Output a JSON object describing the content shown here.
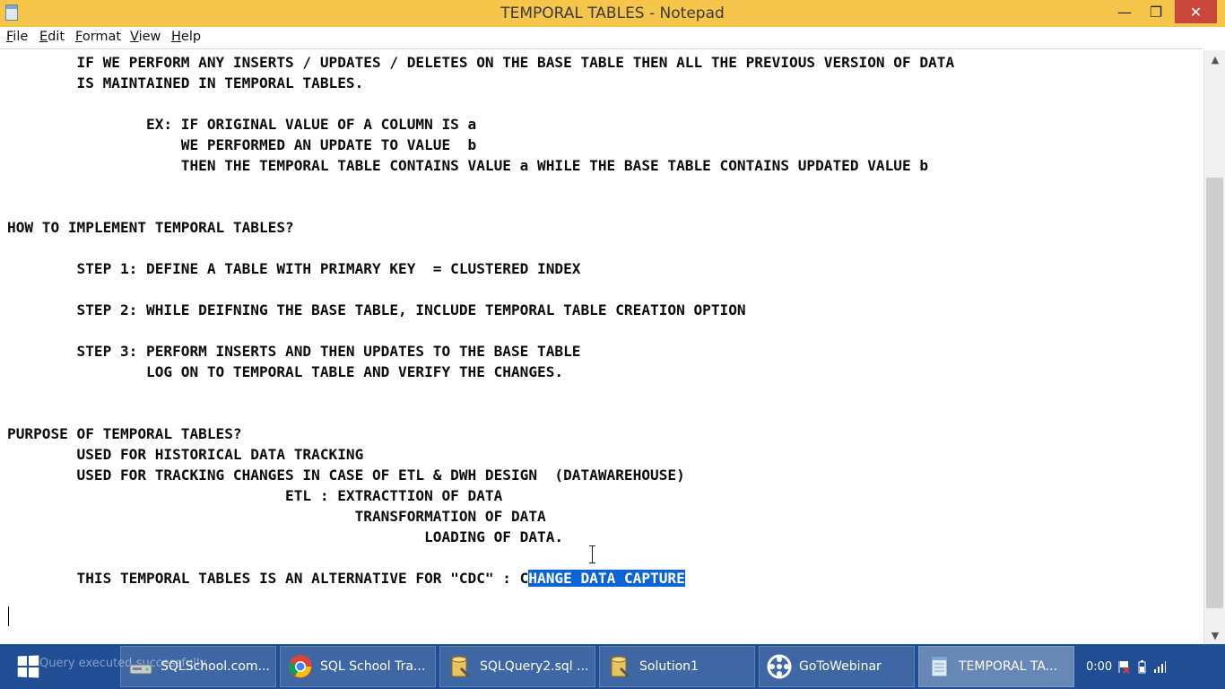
{
  "window": {
    "title": "TEMPORAL TABLES - Notepad",
    "controls": {
      "minimize": "—",
      "maximize": "❐",
      "close": "✕"
    }
  },
  "menu": [
    {
      "label": "File",
      "accel": "F",
      "rest": "ile"
    },
    {
      "label": "Edit",
      "accel": "E",
      "rest": "dit"
    },
    {
      "label": "Format",
      "accel": "F",
      "rest": "ormat",
      "accel_index": 0
    },
    {
      "label": "View",
      "accel": "V",
      "rest": "iew"
    },
    {
      "label": "Help",
      "accel": "H",
      "rest": "elp"
    }
  ],
  "document": {
    "lines": [
      "        IF WE PERFORM ANY INSERTS / UPDATES / DELETES ON THE BASE TABLE THEN ALL THE PREVIOUS VERSION OF DATA",
      "        IS MAINTAINED IN TEMPORAL TABLES.",
      "",
      "                EX: IF ORIGINAL VALUE OF A COLUMN IS a",
      "                    WE PERFORMED AN UPDATE TO VALUE  b",
      "                    THEN THE TEMPORAL TABLE CONTAINS VALUE a WHILE THE BASE TABLE CONTAINS UPDATED VALUE b",
      "",
      "",
      "HOW TO IMPLEMENT TEMPORAL TABLES?",
      "",
      "        STEP 1: DEFINE A TABLE WITH PRIMARY KEY  = CLUSTERED INDEX",
      "",
      "        STEP 2: WHILE DEIFNING THE BASE TABLE, INCLUDE TEMPORAL TABLE CREATION OPTION",
      "",
      "        STEP 3: PERFORM INSERTS AND THEN UPDATES TO THE BASE TABLE",
      "                LOG ON TO TEMPORAL TABLE AND VERIFY THE CHANGES.",
      "",
      "",
      "PURPOSE OF TEMPORAL TABLES?",
      "        USED FOR HISTORICAL DATA TRACKING",
      "        USED FOR TRACKING CHANGES IN CASE OF ETL & DWH DESIGN  (DATAWAREHOUSE)",
      "                                ETL : EXTRACTTION OF DATA",
      "                                        TRANSFORMATION OF DATA",
      "                                                LOADING OF DATA.",
      ""
    ],
    "last_line_prefix": "        THIS TEMPORAL TABLES IS AN ALTERNATIVE FOR \"CDC\" : C",
    "last_line_selected": "HANGE DATA CAPTURE"
  },
  "taskbar": {
    "ghost_text": "Query executed successfully",
    "items": [
      {
        "label": "SQLSchool.com...",
        "icon": "network-drive-icon",
        "active": false
      },
      {
        "label": "SQL School Tra...",
        "icon": "chrome-icon",
        "active": false
      },
      {
        "label": "SQLQuery2.sql ...",
        "icon": "ssms-icon",
        "active": false
      },
      {
        "label": "Solution1",
        "icon": "ssms-icon",
        "active": false
      },
      {
        "label": "GoToWebinar",
        "icon": "gotowebinar-icon",
        "active": false
      },
      {
        "label": "TEMPORAL TA...",
        "icon": "notepad-icon",
        "active": true
      }
    ],
    "tray": {
      "time": "0:00"
    }
  },
  "colors": {
    "titlebar": "#f5c64a",
    "selection": "#0a64d8",
    "taskbar": "#1f4e95",
    "close": "#c7473a"
  }
}
